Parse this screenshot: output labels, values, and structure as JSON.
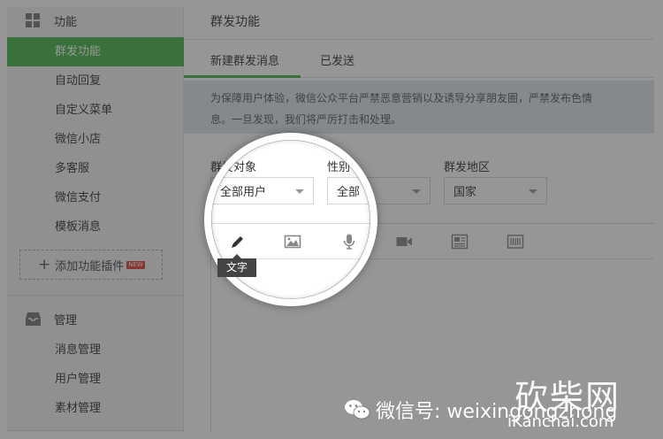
{
  "sidebar": {
    "section1": {
      "label": "功能",
      "icon": "grid-icon"
    },
    "items1": [
      {
        "label": "群发功能",
        "active": true
      },
      {
        "label": "自动回复"
      },
      {
        "label": "自定义菜单"
      },
      {
        "label": "微信小店"
      },
      {
        "label": "多客服"
      },
      {
        "label": "微信支付"
      },
      {
        "label": "模板消息"
      }
    ],
    "add_plugin": {
      "label": "添加功能插件",
      "badge": "NEW"
    },
    "section2": {
      "label": "管理",
      "icon": "inbox-icon"
    },
    "items2": [
      {
        "label": "消息管理"
      },
      {
        "label": "用户管理"
      },
      {
        "label": "素材管理"
      }
    ]
  },
  "main": {
    "title": "群发功能",
    "tabs": [
      {
        "label": "新建群发消息",
        "active": true
      },
      {
        "label": "已发送"
      }
    ],
    "notice_line1": "为保障用户体验，微信公众平台严禁恶意营销以及诱导分享朋友圈，严禁发布色情",
    "notice_line2": "息。一旦发现，我们将严厉打击和处理。",
    "filters": {
      "target": {
        "label": "群发对象",
        "value": "全部用户"
      },
      "gender": {
        "label": "性别",
        "value": "全部"
      },
      "region": {
        "label": "群发地区",
        "value": "国家"
      }
    },
    "toolbar": {
      "tools": [
        "pencil-icon",
        "image-icon",
        "microphone-icon",
        "video-icon",
        "news-icon",
        "barcode-icon"
      ],
      "tooltip": "文字"
    }
  },
  "watermark": {
    "wechat_text": "微信号: weixingongzhong",
    "brand": "砍柴网",
    "site": "iKanchai.com"
  },
  "colors": {
    "accent": "#44b549",
    "overlay": "#2d2d2d"
  }
}
